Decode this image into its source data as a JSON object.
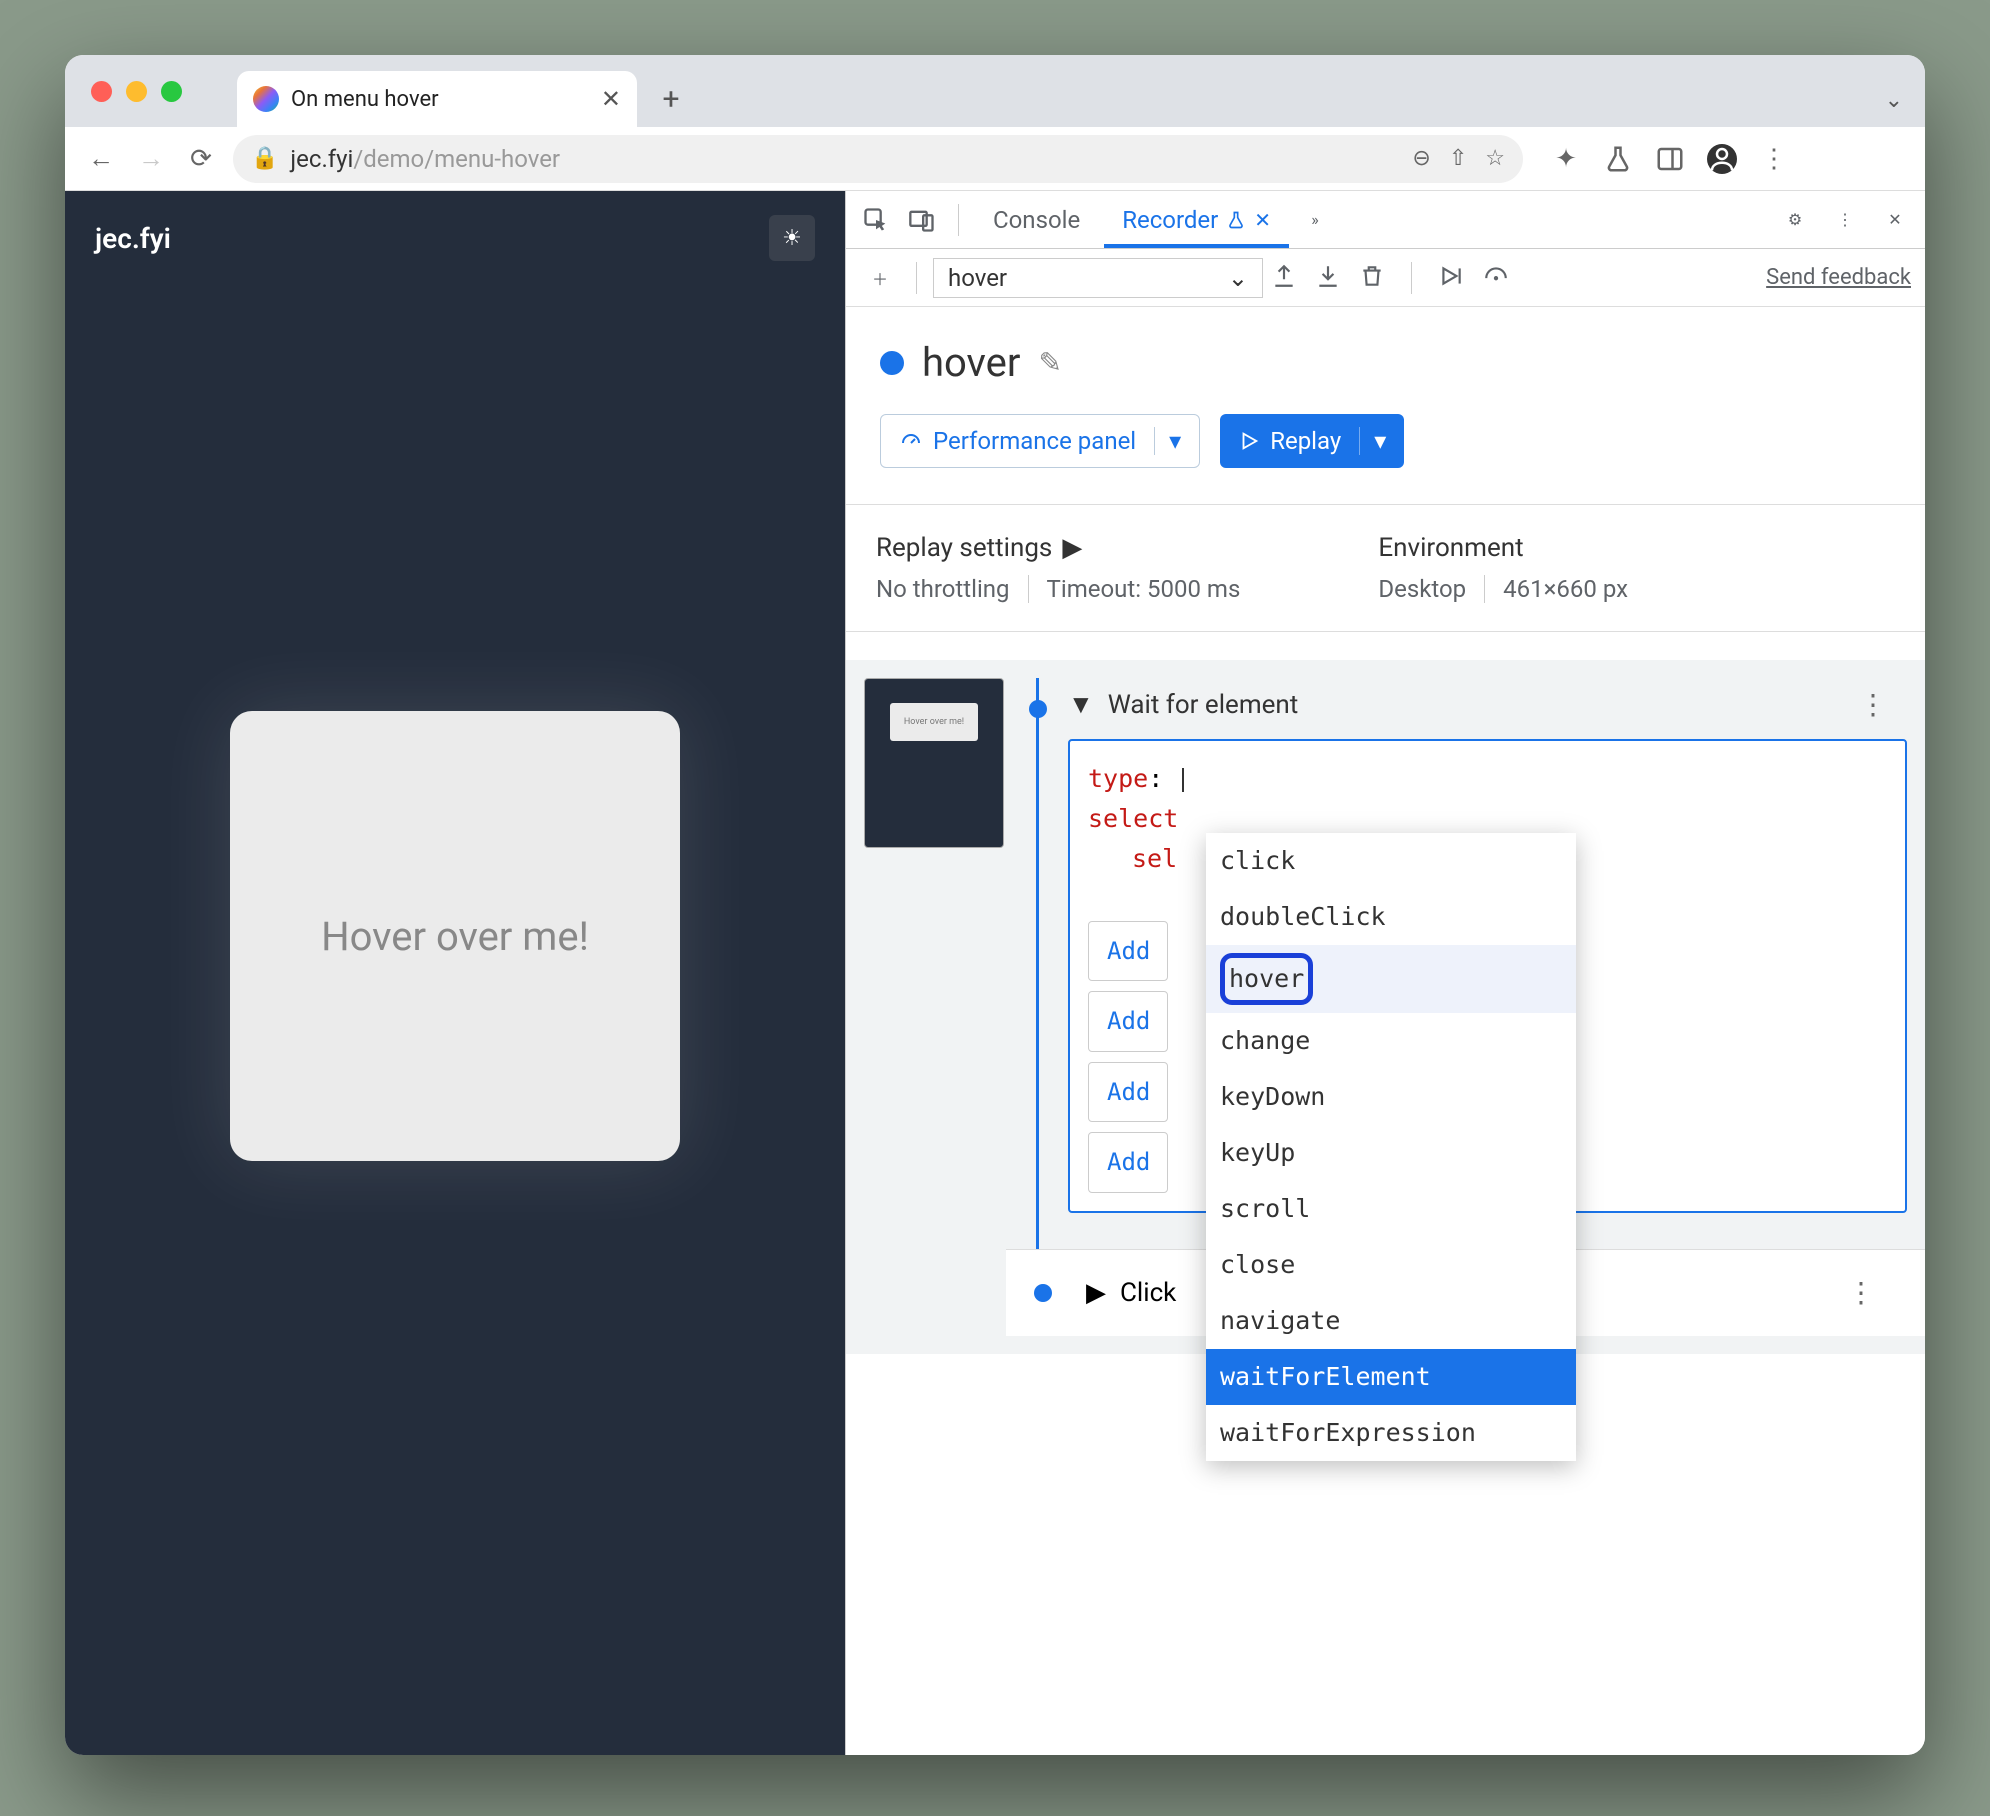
{
  "browser": {
    "tab_title": "On menu hover",
    "url_host": "jec.fyi",
    "url_path": "/demo/menu-hover"
  },
  "page": {
    "title": "jec.fyi",
    "card_text": "Hover over me!"
  },
  "devtools": {
    "tabs": {
      "console": "Console",
      "recorder": "Recorder"
    },
    "feedback": "Send feedback",
    "recording_select": "hover",
    "recording_name": "hover",
    "perf_button": "Performance panel",
    "replay_button": "Replay",
    "replay_settings_title": "Replay settings",
    "throttling": "No throttling",
    "timeout": "Timeout: 5000 ms",
    "environment_title": "Environment",
    "device": "Desktop",
    "viewport": "461×660 px",
    "step1_title": "Wait for element",
    "step1_code": {
      "type_label": "type",
      "selectors_label": "select",
      "sel_prefix": "sel"
    },
    "autocomplete": {
      "items": [
        "click",
        "doubleClick",
        "hover",
        "change",
        "keyDown",
        "keyUp",
        "scroll",
        "close",
        "navigate",
        "waitForElement",
        "waitForExpression"
      ],
      "highlighted_index": 2,
      "ringed_index": 2,
      "selected_index": 9
    },
    "add_buttons": [
      "Add",
      "Add",
      "Add",
      "Add"
    ],
    "step2_title": "Click"
  }
}
